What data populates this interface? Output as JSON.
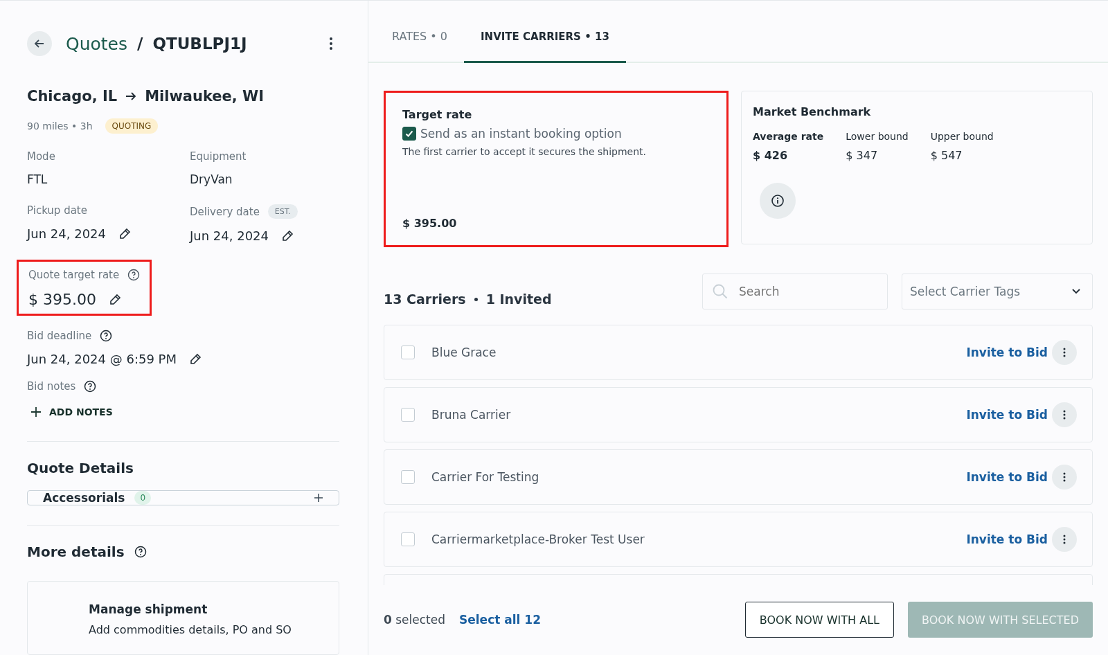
{
  "header": {
    "breadcrumb": "Quotes",
    "separator": "/",
    "quote_id": "QTUBLPJ1J"
  },
  "route": {
    "origin": "Chicago, IL",
    "destination": "Milwaukee, WI",
    "summary": "90 miles • 3h",
    "status": "QUOTING"
  },
  "fields": [
    {
      "label": "Mode",
      "value": "FTL"
    },
    {
      "label": "Equipment",
      "value": "DryVan"
    }
  ],
  "dates": [
    {
      "label": "Pickup date",
      "value": "Jun 24, 2024"
    },
    {
      "label": "Delivery date",
      "badge": "EST.",
      "value": "Jun 24, 2024"
    }
  ],
  "quote_target_rate": {
    "label": "Quote target rate",
    "value": "$ 395.00",
    "highlighted": true
  },
  "bid_deadline": {
    "label": "Bid deadline",
    "value": "Jun 24, 2024 @ 6:59 PM"
  },
  "bid_notes": {
    "label": "Bid notes",
    "action": "ADD NOTES"
  },
  "quote_details": {
    "title": "Quote Details",
    "accessorials": {
      "label": "Accessorials",
      "count": "0"
    }
  },
  "more_details": {
    "title": "More details",
    "card_title": "Manage shipment",
    "card_text": "Add commodities details, PO and SO"
  },
  "tabs": [
    {
      "label": "RATES • 0",
      "selected": false
    },
    {
      "label": "INVITE CARRIERS • 13",
      "selected": true
    }
  ],
  "target_rate": {
    "title": "Target rate",
    "checkbox_label": "Send as an instant booking option",
    "checked": true,
    "note": "The first carrier to accept it secures the shipment.",
    "value": "$ 395.00",
    "highlighted": true
  },
  "benchmark": {
    "title": "Market Benchmark",
    "stats": [
      {
        "label": "Average rate",
        "value": "$ 426",
        "bold": true
      },
      {
        "label": "Lower bound",
        "value": "$ 347",
        "bold": false
      },
      {
        "label": "Upper bound",
        "value": "$ 547",
        "bold": false
      }
    ]
  },
  "carriers_summary": {
    "count": "13 Carriers",
    "invited": "1 Invited"
  },
  "search": {
    "placeholder": "Search"
  },
  "tags_select": {
    "placeholder": "Select Carrier Tags"
  },
  "carriers": [
    {
      "name": "Blue Grace",
      "checked": false,
      "action": "Invite to Bid"
    },
    {
      "name": "Bruna Carrier",
      "checked": false,
      "action": "Invite to Bid"
    },
    {
      "name": "Carrier For Testing",
      "checked": false,
      "action": "Invite to Bid"
    },
    {
      "name": "Carriermarketplace-Broker Test User",
      "checked": false,
      "action": "Invite to Bid"
    }
  ],
  "footer": {
    "selected": "**0** selected",
    "select_all": "Select all 12",
    "buttons": [
      {
        "label": "BOOK NOW WITH ALL",
        "disabled": false
      },
      {
        "label": "BOOK NOW WITH SELECTED",
        "disabled": true
      }
    ]
  }
}
